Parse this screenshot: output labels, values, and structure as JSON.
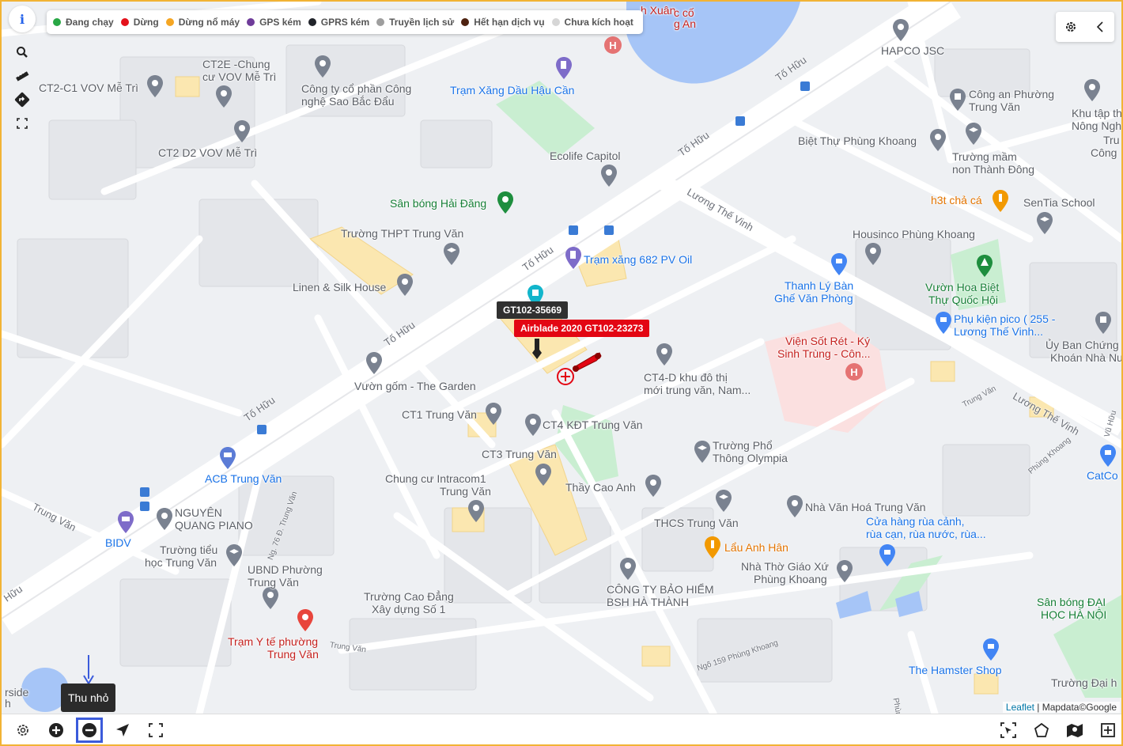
{
  "legend": [
    {
      "label": "Đang chạy",
      "color": "#28a745"
    },
    {
      "label": "Dừng",
      "color": "#e4111b"
    },
    {
      "label": "Dừng nổ máy",
      "color": "#f5a623"
    },
    {
      "label": "GPS kém",
      "color": "#6f3c9a"
    },
    {
      "label": "GPRS kém",
      "color": "#20232a"
    },
    {
      "label": "Truyền lịch sử",
      "color": "#9e9e9e"
    },
    {
      "label": "Hết hạn dịch vụ",
      "color": "#4e2210"
    },
    {
      "label": "Chưa kích hoạt",
      "color": "#d6d6d6"
    }
  ],
  "left_tools": {
    "info": "i",
    "icons": [
      "search-icon",
      "ruler-icon",
      "directions-icon",
      "fullscreen-icon"
    ]
  },
  "top_right": {
    "icons": [
      "settings-icon",
      "collapse-icon"
    ]
  },
  "vehicles": [
    {
      "plate": "GT102-35669",
      "status": "GPRS kém"
    },
    {
      "plate": "Airblade 2020 GT102-23273",
      "status": "Dừng"
    }
  ],
  "map_labels": {
    "poi": [
      "CT2E -Chung",
      "cư VOV Mễ Trì",
      "CT2-C1 VOV Mễ Trì",
      "CT2 D2 VOV Mễ Trì",
      "Công ty cổ phần Công",
      "nghệ Sao Bắc Đẩu",
      "Trạm Xăng Dầu Hậu Cần",
      "Ecolife Capitol",
      "HAPCO JSC",
      "Công an Phường",
      "Trung Văn",
      "Khu tập th",
      "Nông Ngh",
      "Tru",
      "Công",
      "Biệt Thự Phùng Khoang",
      "Trường mầm",
      "non Thành Đông",
      "h3t chả cá",
      "SenTia School",
      "Sân bóng Hải Đăng",
      "Trường THPT Trung Văn",
      "Trạm xăng 682 PV Oil",
      "Housinco Phùng Khoang",
      "Linen & Silk House",
      "Thanh Lý Bàn",
      "Ghế Văn Phòng",
      "Vườn Hoa Biệt",
      "Thự Quốc Hội",
      "Phụ kiện pico ( 255 -",
      "Lương Thế Vinh...",
      "Ủy Ban Chứng",
      "Khoán Nhà Nước",
      "Viện Sốt Rét - Ký",
      "Sinh Trùng - Côn...",
      "Vườn gốm - The Garden",
      "CT4-D khu đô thị",
      "mới trung văn, Nam...",
      "CT1 Trung Văn",
      "CT4 KĐT Trung Văn",
      "CT3 Trung Văn",
      "Trường Phổ",
      "Thông Olympia",
      "ACB Trung Văn",
      "Chung cư Intracom1",
      "Trung Văn",
      "Thầy Cao Anh",
      "NGUYÊN",
      "QUANG PIANO",
      "BIDV",
      "Nhà Văn Hoá Trung Văn",
      "Cửa hàng rùa cảnh,",
      "rùa cạn, rùa nước, rùa...",
      "Trường tiểu",
      "học Trung Văn",
      "THCS Trung Văn",
      "Lẩu Anh Hân",
      "UBND Phường",
      "Trung Văn",
      "CÔNG TY BẢO HIỂM",
      "BSH HÀ THÀNH",
      "Nhà Thờ Giáo Xứ",
      "Phùng Khoang",
      "Trường Cao Đẳng",
      "Xây dựng Số 1",
      "Trạm Y tế phường",
      "Trung Văn",
      "Sân bóng ĐẠI",
      "HỌC HÀ NỘI",
      "The Hamster Shop",
      "Trường Đại h",
      "CatCo",
      "h Xuân",
      "c cố",
      "g An",
      "rside",
      "h"
    ],
    "roads": [
      "Tố Hữu",
      "Lương Thế Vinh",
      "Trung Văn",
      "Ng. 76 Đ. Trung Văn",
      "Ngõ 159 Phùng Khoang",
      "Phùng Khoang",
      "Trung Văn",
      "Vũ Hữu",
      "Hữu",
      "Phùng Kh"
    ]
  },
  "bottom_bar": {
    "tooltip": "Thu nhỏ",
    "left_icons": [
      "settings-icon",
      "zoom-in-icon",
      "zoom-out-icon",
      "locate-icon",
      "fit-bounds-icon"
    ],
    "right_icons": [
      "select-area-icon",
      "polygon-icon",
      "map-layers-icon",
      "add-icon"
    ]
  },
  "attribution": {
    "link": "Leaflet",
    "sep": " | ",
    "text": "Mapdata©Google"
  }
}
